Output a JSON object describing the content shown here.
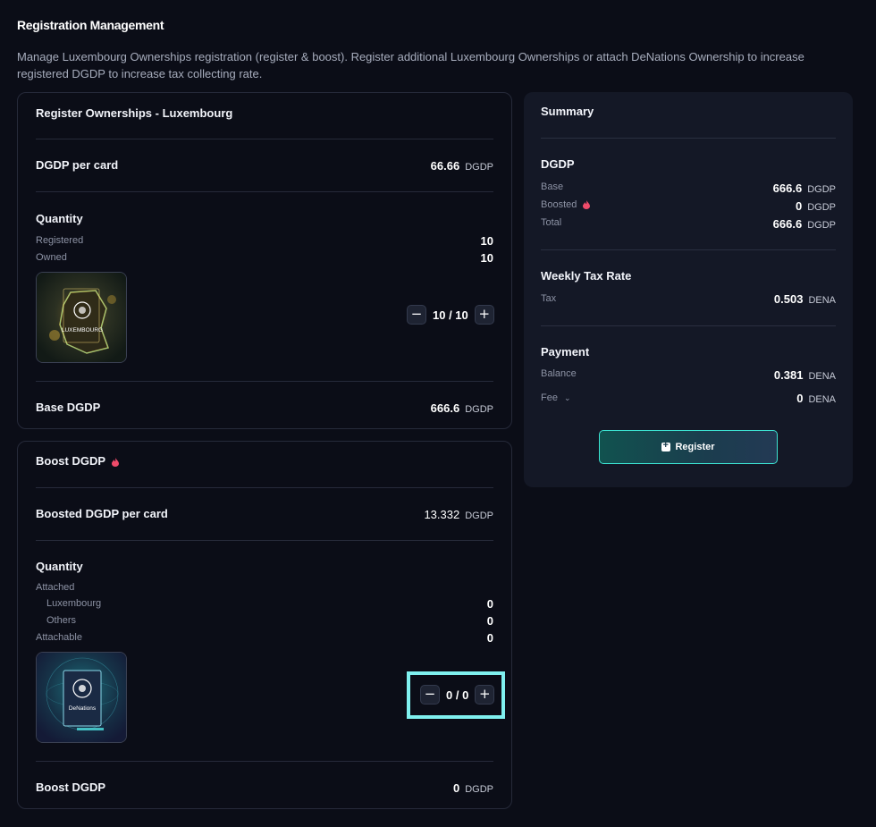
{
  "page": {
    "title": "Registration Management",
    "description": "Manage Luxembourg Ownerships registration (register & boost). Register additional Luxembourg Ownerships or attach DeNations Ownership to increase registered DGDP to increase tax collecting rate."
  },
  "register": {
    "header": "Register Ownerships - Luxembourg",
    "dgdp_per_card_label": "DGDP per card",
    "dgdp_per_card_value": "66.66",
    "unit": "DGDP",
    "quantity_label": "Quantity",
    "registered_label": "Registered",
    "registered_value": "10",
    "owned_label": "Owned",
    "owned_value": "10",
    "card_image_name": "LUXEMBOURG",
    "stepper_value": "10 / 10",
    "base_dgdp_label": "Base DGDP",
    "base_dgdp_value": "666.6"
  },
  "boost": {
    "header": "Boost DGDP",
    "boosted_per_card_label": "Boosted DGDP per card",
    "boosted_per_card_value": "13.332",
    "unit": "DGDP",
    "quantity_label": "Quantity",
    "attached_label": "Attached",
    "luxembourg_label": "Luxembourg",
    "luxembourg_value": "0",
    "others_label": "Others",
    "others_value": "0",
    "attachable_label": "Attachable",
    "attachable_value": "0",
    "card_image_name": "DeNations",
    "stepper_value": "0 / 0",
    "boost_dgdp_label": "Boost DGDP",
    "boost_dgdp_value": "0"
  },
  "summary": {
    "header": "Summary",
    "dgdp_section": "DGDP",
    "base_label": "Base",
    "base_value": "666.6",
    "boosted_label": "Boosted",
    "boosted_value": "0",
    "total_label": "Total",
    "total_value": "666.6",
    "dgdp_unit": "DGDP",
    "tax_section": "Weekly Tax Rate",
    "tax_label": "Tax",
    "tax_value": "0.503",
    "dena_unit": "DENA",
    "payment_section": "Payment",
    "balance_label": "Balance",
    "balance_value": "0.381",
    "fee_label": "Fee",
    "fee_value": "0",
    "register_button": "Register"
  },
  "colors": {
    "background": "#0b0d17",
    "card_border": "#262a3a",
    "summary_bg": "#141826",
    "accent_teal": "#3ce3d2",
    "highlight": "#7ff0ef",
    "flame": "#ef4b6a"
  },
  "icons": [
    "flame-icon",
    "minus-icon",
    "plus-icon",
    "chevron-down-icon",
    "register-plus-icon"
  ]
}
